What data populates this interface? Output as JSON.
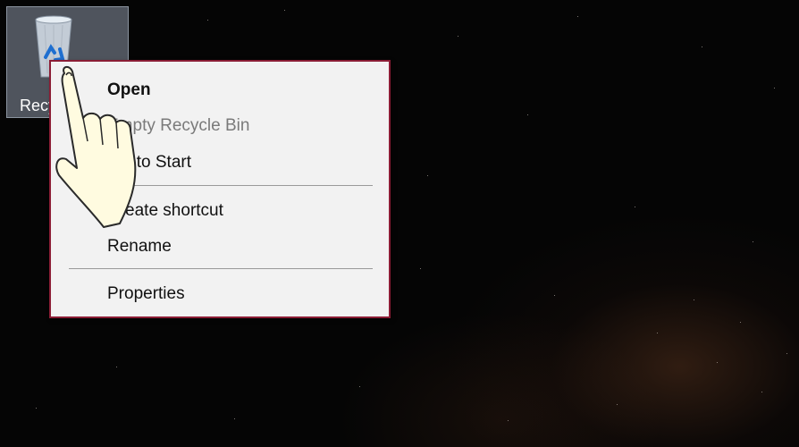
{
  "desktop": {
    "recycle_bin_label": "Recycle Bin"
  },
  "context_menu": {
    "items": [
      {
        "label": "Open",
        "style": "bold"
      },
      {
        "label": "Empty Recycle Bin",
        "style": "disabled"
      },
      {
        "label": "Pin to Start",
        "style": "normal"
      },
      {
        "label": "Create shortcut",
        "style": "normal"
      },
      {
        "label": "Rename",
        "style": "normal"
      },
      {
        "label": "Properties",
        "style": "normal"
      }
    ],
    "border_color": "#8b1d35"
  },
  "icons": {
    "desktop_icon": "recycle-bin-icon",
    "overlay": "pointing-hand-icon"
  }
}
